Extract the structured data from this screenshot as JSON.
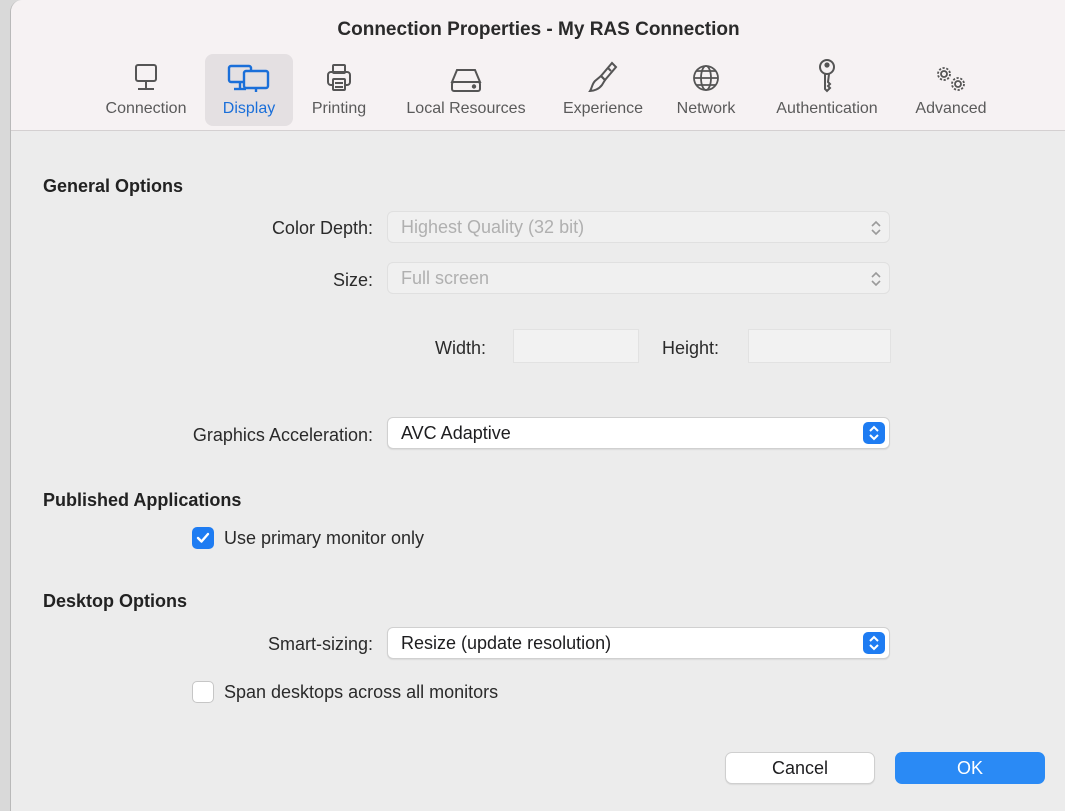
{
  "window": {
    "title": "Connection Properties - My RAS Connection"
  },
  "tabs": [
    {
      "label": "Connection",
      "icon": "monitor-icon"
    },
    {
      "label": "Display",
      "icon": "displays-icon",
      "active": true
    },
    {
      "label": "Printing",
      "icon": "printer-icon"
    },
    {
      "label": "Local Resources",
      "icon": "drive-icon"
    },
    {
      "label": "Experience",
      "icon": "paintbrush-icon"
    },
    {
      "label": "Network",
      "icon": "globe-icon"
    },
    {
      "label": "Authentication",
      "icon": "key-icon"
    },
    {
      "label": "Advanced",
      "icon": "gears-icon"
    }
  ],
  "general": {
    "heading": "General Options",
    "color_depth_label": "Color Depth:",
    "color_depth_value": "Highest Quality (32 bit)",
    "size_label": "Size:",
    "size_value": "Full screen",
    "width_label": "Width:",
    "width_value": "",
    "height_label": "Height:",
    "height_value": "",
    "graphics_label": "Graphics Acceleration:",
    "graphics_value": "AVC Adaptive"
  },
  "published": {
    "heading": "Published Applications",
    "primary_monitor_label": "Use primary monitor only",
    "primary_monitor_checked": true
  },
  "desktop": {
    "heading": "Desktop Options",
    "smart_sizing_label": "Smart-sizing:",
    "smart_sizing_value": "Resize (update resolution)",
    "span_label": "Span desktops across all monitors",
    "span_checked": false
  },
  "buttons": {
    "cancel": "Cancel",
    "ok": "OK"
  },
  "colors": {
    "accent": "#1e7cf2",
    "active_tab_text": "#1a6fd9"
  }
}
